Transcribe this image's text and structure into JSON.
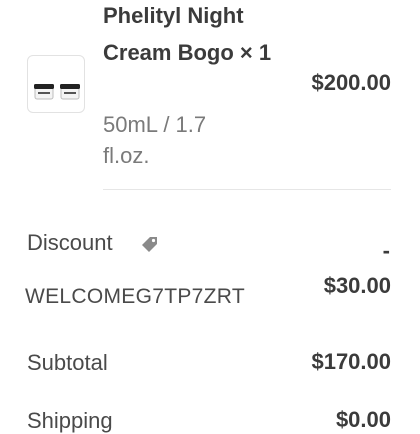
{
  "line_item": {
    "name": "Phelityl Night Cream Bogo × 1",
    "variant": "50mL / 1.7 fl.oz.",
    "price": "$200.00",
    "thumbnail_icon": "two-cream-jars"
  },
  "discount": {
    "label": "Discount",
    "icon": "tag-icon",
    "code": "WELCOMEG7TP7ZRT",
    "sign": "-",
    "amount": "$30.00"
  },
  "subtotal": {
    "label": "Subtotal",
    "value": "$170.00"
  },
  "shipping": {
    "label": "Shipping",
    "value": "$0.00"
  },
  "colors": {
    "text_primary": "#3b3b3b",
    "text_secondary": "#7a7a7a",
    "divider": "#e6e6e6",
    "tag_icon": "#8a8a8a"
  }
}
